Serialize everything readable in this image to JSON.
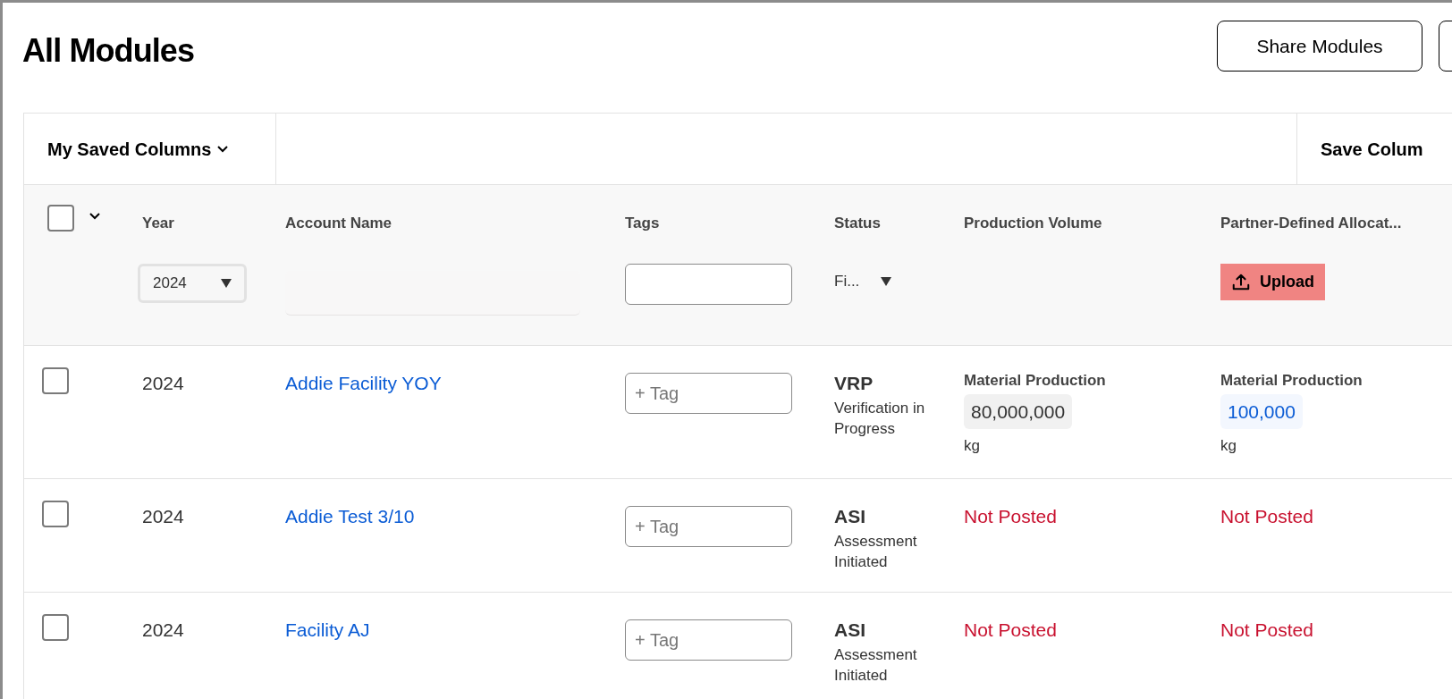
{
  "page": {
    "title": "All Modules"
  },
  "actions": [
    {
      "kind": "labeled",
      "label": "Share Modules"
    },
    {
      "kind": "cut_off"
    }
  ],
  "toolbar": {
    "saved_columns": "My Saved Columns",
    "save_columns": "Save Colum"
  },
  "table": {
    "select_all": {
      "checked": false
    },
    "columns": [
      {
        "label": "Year",
        "filter": {
          "kind": "select",
          "value": "2024"
        }
      },
      {
        "label": "Account Name",
        "filter": {
          "kind": "text"
        }
      },
      {
        "label": "Tags",
        "filter": {
          "kind": "input"
        }
      },
      {
        "label": "Status",
        "filter": {
          "kind": "dropdown",
          "value": "Fi..."
        }
      },
      {
        "label": "Production Volume"
      },
      {
        "label": "Partner-Defined Allocat...",
        "filter": {
          "kind": "upload",
          "value": "Upload"
        }
      }
    ],
    "rows": [
      {
        "checked": false,
        "year": "2024",
        "account": "Addie Facility YOY",
        "tag_placeholder": "+ Tag",
        "status_code": "VRP",
        "status_label": "Verification in Progress",
        "production": {
          "kind": "value",
          "label": "Material Production",
          "value": "80,000,000",
          "unit": "kg"
        },
        "partner": {
          "kind": "link_value",
          "label": "Material Production",
          "value": "100,000",
          "unit": "kg"
        }
      },
      {
        "checked": false,
        "year": "2024",
        "account": "Addie Test 3/10",
        "tag_placeholder": "+ Tag",
        "status_code": "ASI",
        "status_label": "Assessment Initiated",
        "production": {
          "kind": "not_posted",
          "value": "Not Posted"
        },
        "partner": {
          "kind": "not_posted",
          "value": "Not Posted"
        }
      },
      {
        "checked": false,
        "year": "2024",
        "account": "Facility AJ",
        "tag_placeholder": "+ Tag",
        "status_code": "ASI",
        "status_label": "Assessment Initiated",
        "production": {
          "kind": "not_posted",
          "value": "Not Posted"
        },
        "partner": {
          "kind": "not_posted",
          "value": "Not Posted"
        }
      }
    ]
  }
}
